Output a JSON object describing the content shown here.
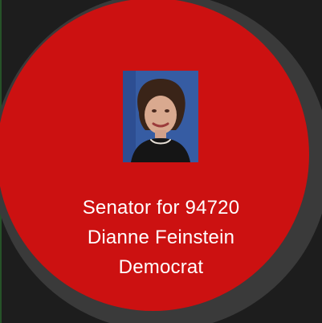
{
  "card": {
    "title": "Senator for 94720",
    "name": "Dianne Feinstein",
    "party": "Democrat"
  },
  "colors": {
    "face": "#cc1111",
    "bezel": "#3a3a3a",
    "background": "#1d1d1d",
    "text": "#ffffff"
  },
  "icons": {
    "photo": "senator-portrait"
  }
}
